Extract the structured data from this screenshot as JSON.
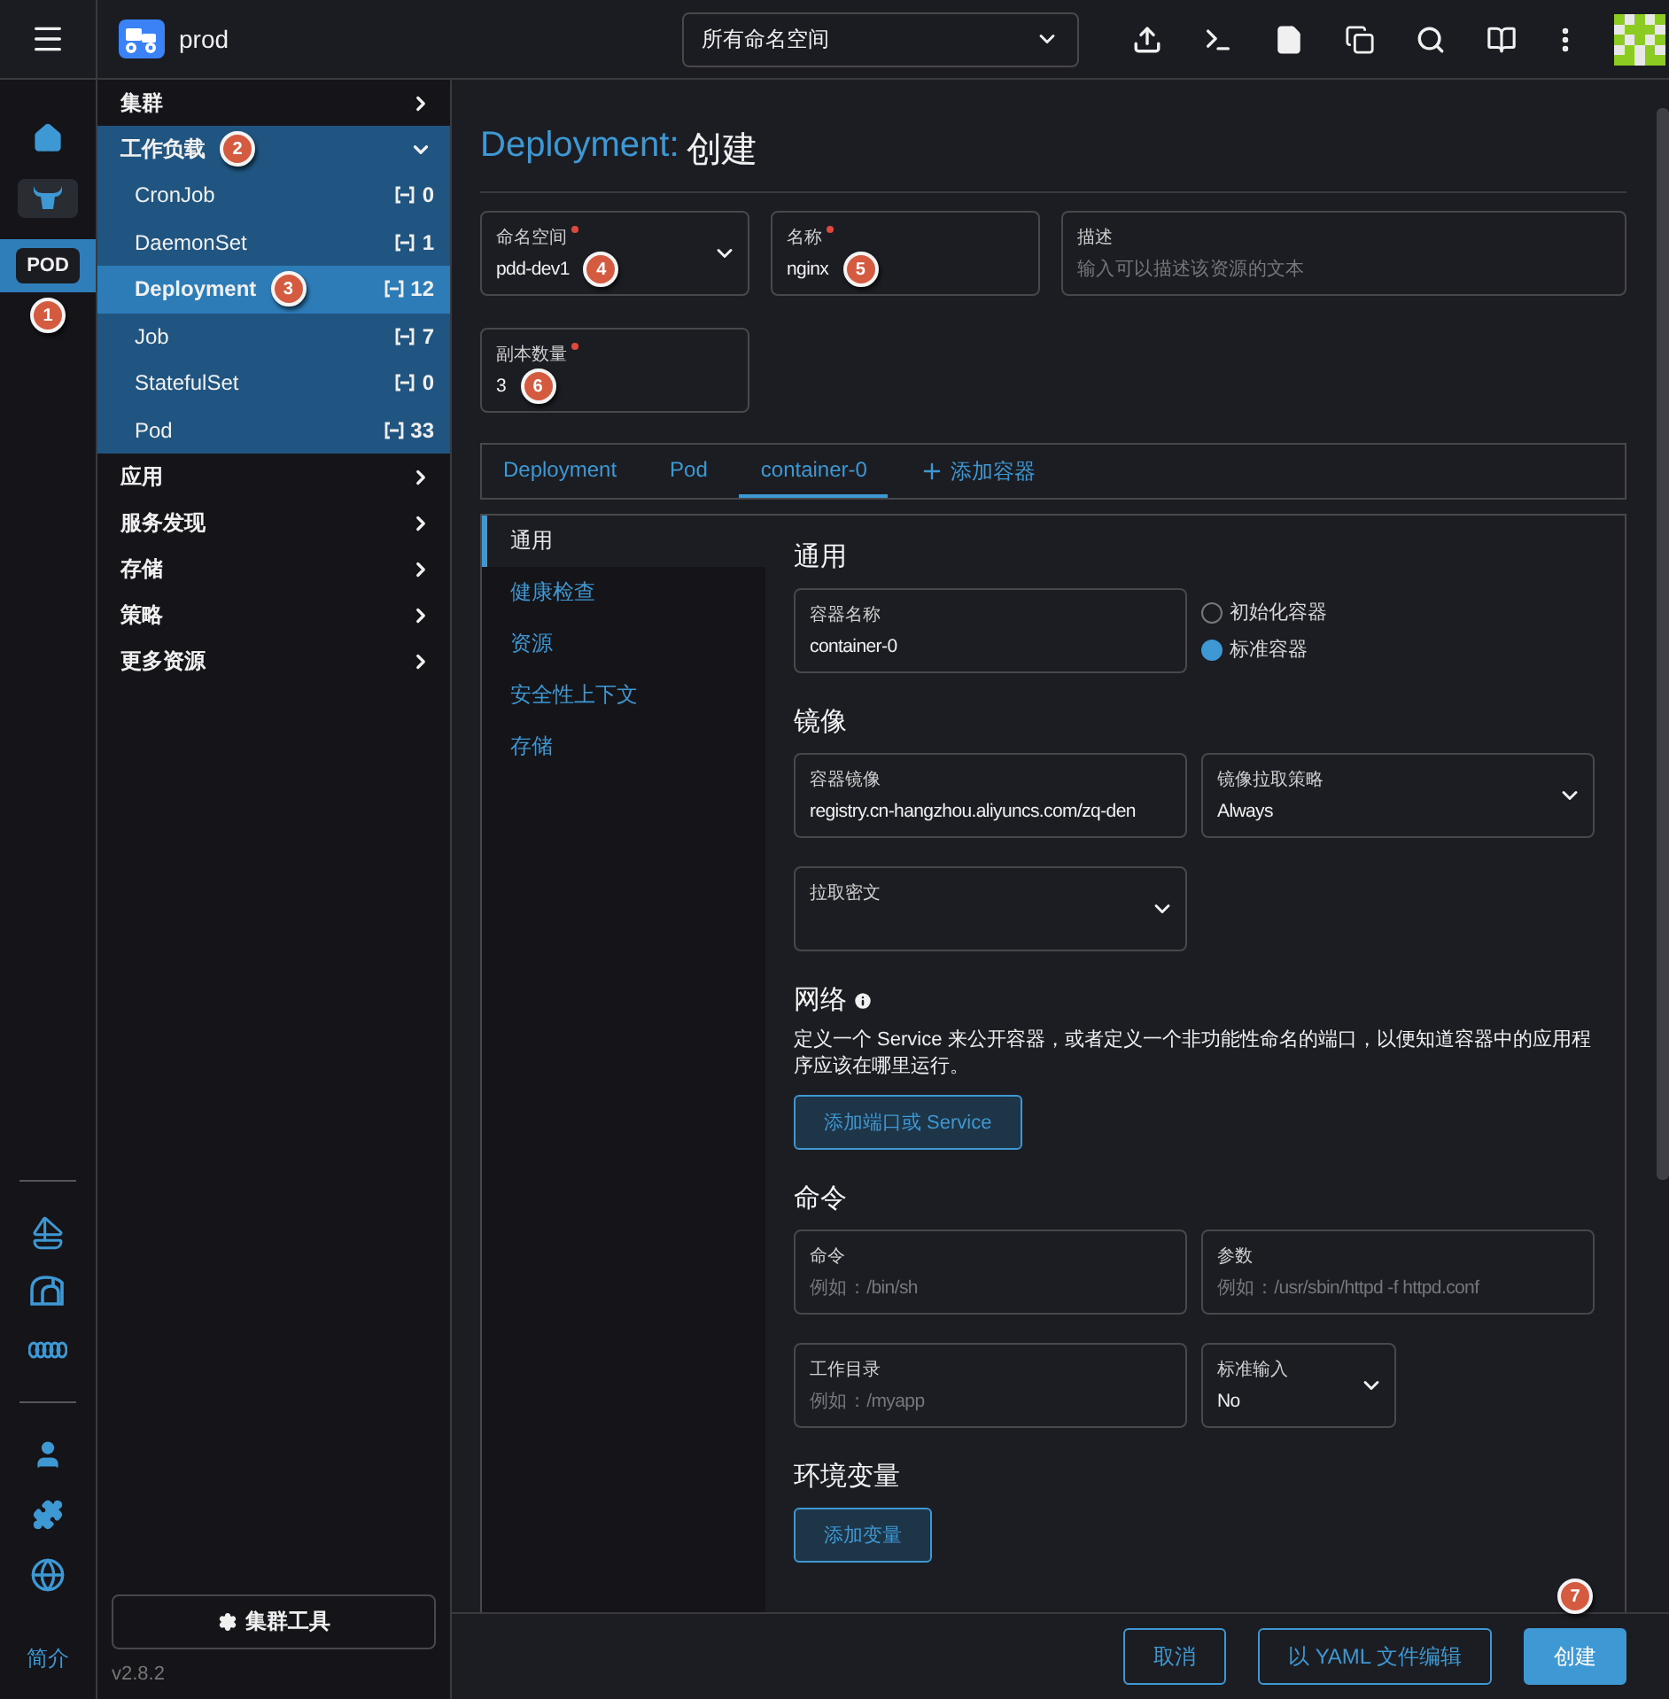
{
  "header": {
    "app_title": "prod",
    "namespace_filter": "所有命名空间"
  },
  "rail": {
    "clusters": [
      {
        "label": "POD",
        "selected": true,
        "callout": "1"
      }
    ],
    "about_link": "简介"
  },
  "sidebar": {
    "groups": [
      {
        "label": "集群",
        "expanded": false
      },
      {
        "label": "工作负载",
        "expanded": true,
        "callout": "2",
        "children": [
          {
            "label": "CronJob",
            "count": "0",
            "selected": false
          },
          {
            "label": "DaemonSet",
            "count": "1",
            "selected": false
          },
          {
            "label": "Deployment",
            "count": "12",
            "selected": true,
            "callout": "3"
          },
          {
            "label": "Job",
            "count": "7",
            "selected": false
          },
          {
            "label": "StatefulSet",
            "count": "0",
            "selected": false
          },
          {
            "label": "Pod",
            "count": "33",
            "selected": false
          }
        ]
      },
      {
        "label": "应用",
        "expanded": false
      },
      {
        "label": "服务发现",
        "expanded": false
      },
      {
        "label": "存储",
        "expanded": false
      },
      {
        "label": "策略",
        "expanded": false
      },
      {
        "label": "更多资源",
        "expanded": false
      }
    ],
    "tools_button": "集群工具",
    "version": "v2.8.2"
  },
  "page": {
    "title": {
      "resource": "Deployment:",
      "action": "创建"
    },
    "meta_fields": [
      {
        "label": "命名空间",
        "required": true,
        "kind": "select",
        "value": "pdd-dev1",
        "callout": "4"
      },
      {
        "label": "名称",
        "required": true,
        "kind": "text",
        "value": "nginx",
        "callout": "5"
      },
      {
        "label": "描述",
        "required": false,
        "kind": "text",
        "placeholder": "输入可以描述该资源的文本"
      },
      {
        "label": "副本数量",
        "required": true,
        "kind": "text",
        "value": "3",
        "callout": "6"
      }
    ],
    "tabs": [
      {
        "label": "Deployment",
        "selected": false
      },
      {
        "label": "Pod",
        "selected": false
      },
      {
        "label": "container-0",
        "selected": true
      }
    ],
    "add_tab": "添加容器",
    "side_tabs": [
      {
        "label": "通用",
        "selected": true
      },
      {
        "label": "健康检查",
        "selected": false
      },
      {
        "label": "资源",
        "selected": false
      },
      {
        "label": "安全性上下文",
        "selected": false
      },
      {
        "label": "存储",
        "selected": false
      }
    ],
    "sections": [
      {
        "heading": "通用",
        "fields": [
          {
            "label": "容器名称",
            "kind": "text",
            "value": "container-0"
          },
          {
            "kind": "radio_group",
            "options": [
              {
                "label": "初始化容器",
                "selected": false
              },
              {
                "label": "标准容器",
                "selected": true
              }
            ]
          }
        ]
      },
      {
        "heading": "镜像",
        "fields": [
          {
            "label": "容器镜像",
            "kind": "text",
            "value": "registry.cn-hangzhou.aliyuncs.com/zq-den"
          },
          {
            "label": "镜像拉取策略",
            "kind": "select",
            "value": "Always"
          },
          {
            "label": "拉取密文",
            "kind": "select"
          }
        ]
      },
      {
        "heading": "网络",
        "info": true,
        "description": "定义一个 Service 来公开容器，或者定义一个非功能性命名的端口，以便知道容器中的应用程序应该在哪里运行。",
        "button": "添加端口或 Service"
      },
      {
        "heading": "命令",
        "fields": [
          {
            "label": "命令",
            "kind": "text",
            "placeholder": "例如：/bin/sh"
          },
          {
            "label": "参数",
            "kind": "text",
            "placeholder": "例如：/usr/sbin/httpd -f httpd.conf"
          },
          {
            "label": "工作目录",
            "kind": "text",
            "placeholder": "例如：/myapp"
          },
          {
            "label": "标准输入",
            "kind": "compact_select",
            "value": "No"
          }
        ]
      },
      {
        "heading": "环境变量",
        "button": "添加变量"
      }
    ],
    "footer_buttons": [
      {
        "label": "取消",
        "kind": "secondary"
      },
      {
        "label": "以 YAML 文件编辑",
        "kind": "secondary"
      },
      {
        "label": "创建",
        "kind": "primary",
        "callout": "7"
      }
    ]
  }
}
